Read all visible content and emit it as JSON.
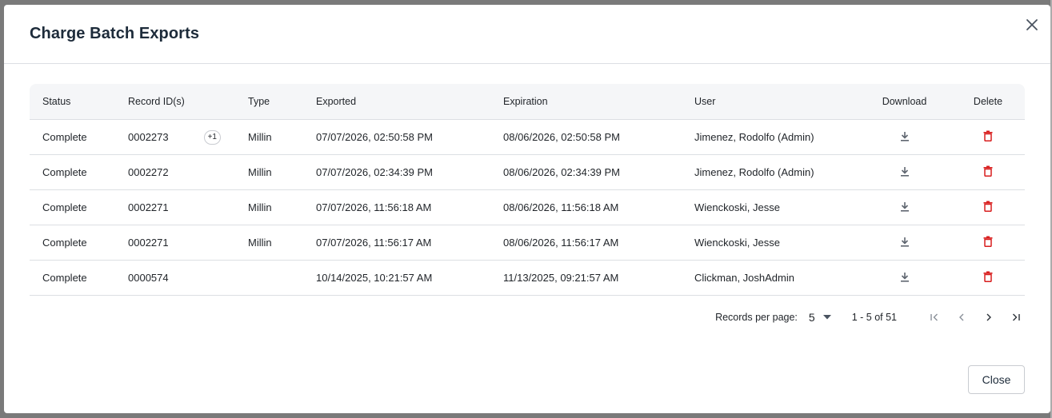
{
  "dialog": {
    "title": "Charge Batch Exports",
    "close_label": "Close"
  },
  "table": {
    "headers": {
      "status": "Status",
      "record_ids": "Record ID(s)",
      "type": "Type",
      "exported": "Exported",
      "expiration": "Expiration",
      "user": "User",
      "download": "Download",
      "delete": "Delete"
    },
    "rows": [
      {
        "status": "Complete",
        "record_id": "0002273",
        "extra": "+1",
        "type": "Millin",
        "exported": "07/07/2026, 02:50:58 PM",
        "expiration": "08/06/2026, 02:50:58 PM",
        "user": "Jimenez, Rodolfo (Admin)"
      },
      {
        "status": "Complete",
        "record_id": "0002272",
        "extra": "",
        "type": "Millin",
        "exported": "07/07/2026, 02:34:39 PM",
        "expiration": "08/06/2026, 02:34:39 PM",
        "user": "Jimenez, Rodolfo (Admin)"
      },
      {
        "status": "Complete",
        "record_id": "0002271",
        "extra": "",
        "type": "Millin",
        "exported": "07/07/2026, 11:56:18 AM",
        "expiration": "08/06/2026, 11:56:18 AM",
        "user": "Wienckoski, Jesse"
      },
      {
        "status": "Complete",
        "record_id": "0002271",
        "extra": "",
        "type": "Millin",
        "exported": "07/07/2026, 11:56:17 AM",
        "expiration": "08/06/2026, 11:56:17 AM",
        "user": "Wienckoski, Jesse"
      },
      {
        "status": "Complete",
        "record_id": "0000574",
        "extra": "",
        "type": "",
        "exported": "10/14/2025, 10:21:57 AM",
        "expiration": "11/13/2025, 09:21:57 AM",
        "user": "Clickman, JoshAdmin"
      }
    ]
  },
  "pagination": {
    "per_page_label": "Records per page:",
    "per_page_value": "5",
    "range_text": "1 - 5 of 51"
  },
  "icons": {
    "close": "close-icon",
    "download": "download-icon",
    "delete": "trash-icon",
    "first": "first-page-icon",
    "prev": "chevron-left-icon",
    "next": "chevron-right-icon",
    "last": "last-page-icon",
    "dropdown": "caret-down-icon"
  },
  "colors": {
    "delete_icon": "#d81e1e",
    "download_icon": "#5f6670",
    "title": "#1d2b3a"
  }
}
